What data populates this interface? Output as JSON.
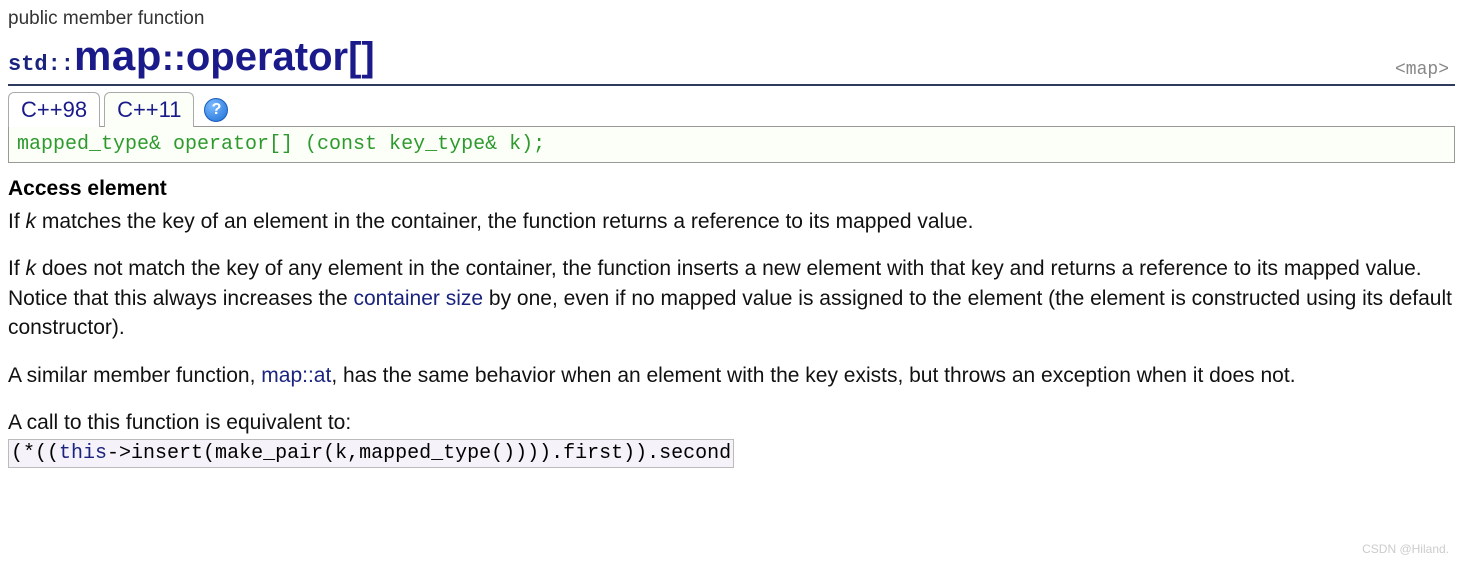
{
  "category": "public member function",
  "namespace": "std::",
  "class_name": "map",
  "separator": "::",
  "function_name": "operator[]",
  "include_header": "<map>",
  "tabs": [
    {
      "label": "C++98"
    },
    {
      "label": "C++11"
    }
  ],
  "help_symbol": "?",
  "signature": "mapped_type& operator[] (const key_type& k);",
  "section_title": "Access element",
  "para1_pre": "If ",
  "para1_k": "k",
  "para1_post": " matches the key of an element in the container, the function returns a reference to its mapped value.",
  "para2_pre": "If ",
  "para2_k": "k",
  "para2_mid": " does not match the key of any element in the container, the function inserts a new element with that key and returns a reference to its mapped value. Notice that this always increases the ",
  "para2_link": "container size",
  "para2_post": " by one, even if no mapped value is assigned to the element (the element is constructed using its default constructor).",
  "para3_pre": "A similar member function, ",
  "para3_link": "map::at",
  "para3_post": ", has the same behavior when an element with the key exists, but throws an exception when it does not.",
  "para4": "A call to this function is equivalent to:",
  "equiv_p1": "(*((",
  "equiv_kw": "this",
  "equiv_p2": "->",
  "equiv_p3": "insert(make_pair(k,mapped_type()))).first)).second",
  "watermark": "CSDN @Hiland."
}
